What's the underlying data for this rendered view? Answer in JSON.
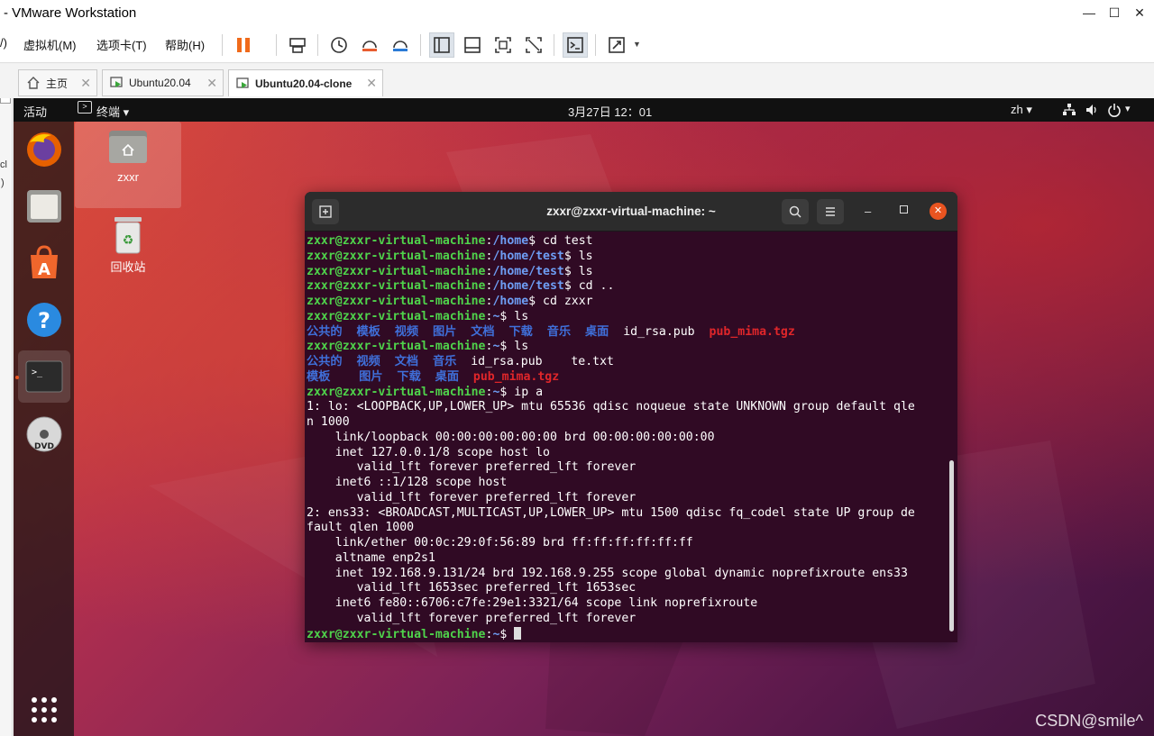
{
  "window": {
    "title": "- VMware Workstation"
  },
  "menu": [
    {
      "label": "/)"
    },
    {
      "label": "虚拟机(M)"
    },
    {
      "label": "选项卡(T)"
    },
    {
      "label": "帮助(H)"
    }
  ],
  "tabs": [
    {
      "label": "主页"
    },
    {
      "label": "Ubuntu20.04"
    },
    {
      "label": "Ubuntu20.04-clone"
    }
  ],
  "left_sliver": {
    "text1": "x",
    "text2": "cl",
    "text3": ")"
  },
  "ubuntu_topbar": {
    "activities": "活动",
    "app_menu": "终端 ▾",
    "clock": "3月27日  12：01",
    "input_method": "zh ▾"
  },
  "desktop_icons": [
    {
      "label": "zxxr"
    },
    {
      "label": "回收站"
    }
  ],
  "terminal": {
    "title": "zxxr@zxxr-virtual-machine: ~",
    "lines": [
      [
        {
          "t": "zxxr@zxxr-virtual-machine",
          "c": "g"
        },
        {
          "t": ":",
          "c": ""
        },
        {
          "t": "/home",
          "c": "b"
        },
        {
          "t": "$ cd test",
          "c": ""
        }
      ],
      [
        {
          "t": "zxxr@zxxr-virtual-machine",
          "c": "g"
        },
        {
          "t": ":",
          "c": ""
        },
        {
          "t": "/home/test",
          "c": "b"
        },
        {
          "t": "$ ls",
          "c": ""
        }
      ],
      [
        {
          "t": "zxxr@zxxr-virtual-machine",
          "c": "g"
        },
        {
          "t": ":",
          "c": ""
        },
        {
          "t": "/home/test",
          "c": "b"
        },
        {
          "t": "$ ls",
          "c": ""
        }
      ],
      [
        {
          "t": "zxxr@zxxr-virtual-machine",
          "c": "g"
        },
        {
          "t": ":",
          "c": ""
        },
        {
          "t": "/home/test",
          "c": "b"
        },
        {
          "t": "$ cd ..",
          "c": ""
        }
      ],
      [
        {
          "t": "zxxr@zxxr-virtual-machine",
          "c": "g"
        },
        {
          "t": ":",
          "c": ""
        },
        {
          "t": "/home",
          "c": "b"
        },
        {
          "t": "$ cd zxxr",
          "c": ""
        }
      ],
      [
        {
          "t": "zxxr@zxxr-virtual-machine",
          "c": "g"
        },
        {
          "t": ":",
          "c": ""
        },
        {
          "t": "~",
          "c": "b"
        },
        {
          "t": "$ ls",
          "c": ""
        }
      ],
      [
        {
          "t": "公共的  模板  视频  图片  文档  下载  音乐  桌面",
          "c": "bl"
        },
        {
          "t": "  id_rsa.pub  ",
          "c": ""
        },
        {
          "t": "pub_mima.tgz",
          "c": "r"
        }
      ],
      [
        {
          "t": "zxxr@zxxr-virtual-machine",
          "c": "g"
        },
        {
          "t": ":",
          "c": ""
        },
        {
          "t": "~",
          "c": "b"
        },
        {
          "t": "$ ls",
          "c": ""
        }
      ],
      [
        {
          "t": "公共的  视频  文档  音乐",
          "c": "bl"
        },
        {
          "t": "  id_rsa.pub    te.txt",
          "c": ""
        }
      ],
      [
        {
          "t": "模板    图片  下载  桌面",
          "c": "bl"
        },
        {
          "t": "  ",
          "c": ""
        },
        {
          "t": "pub_mima.tgz",
          "c": "r"
        }
      ],
      [
        {
          "t": "zxxr@zxxr-virtual-machine",
          "c": "g"
        },
        {
          "t": ":",
          "c": ""
        },
        {
          "t": "~",
          "c": "b"
        },
        {
          "t": "$ ip a",
          "c": ""
        }
      ],
      [
        {
          "t": "1: lo: <LOOPBACK,UP,LOWER_UP> mtu 65536 qdisc noqueue state UNKNOWN group default qle",
          "c": ""
        }
      ],
      [
        {
          "t": "n 1000",
          "c": ""
        }
      ],
      [
        {
          "t": "    link/loopback 00:00:00:00:00:00 brd 00:00:00:00:00:00",
          "c": ""
        }
      ],
      [
        {
          "t": "    inet 127.0.0.1/8 scope host lo",
          "c": ""
        }
      ],
      [
        {
          "t": "       valid_lft forever preferred_lft forever",
          "c": ""
        }
      ],
      [
        {
          "t": "    inet6 ::1/128 scope host",
          "c": ""
        }
      ],
      [
        {
          "t": "       valid_lft forever preferred_lft forever",
          "c": ""
        }
      ],
      [
        {
          "t": "2: ens33: <BROADCAST,MULTICAST,UP,LOWER_UP> mtu 1500 qdisc fq_codel state UP group de",
          "c": ""
        }
      ],
      [
        {
          "t": "fault qlen 1000",
          "c": ""
        }
      ],
      [
        {
          "t": "    link/ether 00:0c:29:0f:56:89 brd ff:ff:ff:ff:ff:ff",
          "c": ""
        }
      ],
      [
        {
          "t": "    altname enp2s1",
          "c": ""
        }
      ],
      [
        {
          "t": "    inet 192.168.9.131/24 brd 192.168.9.255 scope global dynamic noprefixroute ens33",
          "c": ""
        }
      ],
      [
        {
          "t": "       valid_lft 1653sec preferred_lft 1653sec",
          "c": ""
        }
      ],
      [
        {
          "t": "    inet6 fe80::6706:c7fe:29e1:3321/64 scope link noprefixroute",
          "c": ""
        }
      ],
      [
        {
          "t": "       valid_lft forever preferred_lft forever",
          "c": ""
        }
      ],
      [
        {
          "t": "zxxr@zxxr-virtual-machine",
          "c": "g"
        },
        {
          "t": ":",
          "c": ""
        },
        {
          "t": "~",
          "c": "b"
        },
        {
          "t": "$ ",
          "c": ""
        }
      ]
    ]
  },
  "watermark": "CSDN@smile^"
}
